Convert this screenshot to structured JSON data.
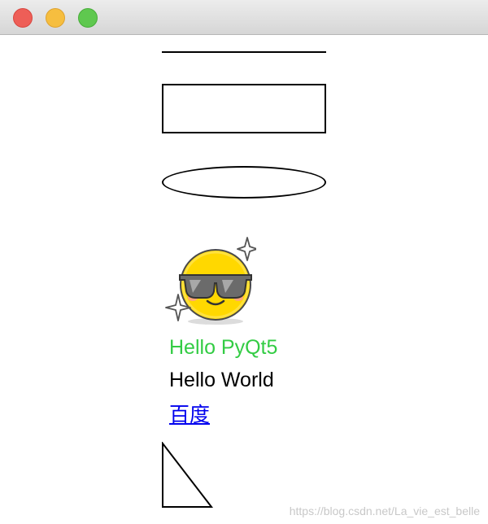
{
  "window": {
    "controls": {
      "close": "close-traffic-light",
      "minimize": "minimize-traffic-light",
      "maximize": "maximize-traffic-light"
    }
  },
  "labels": {
    "greeting": "Hello PyQt5",
    "greeting_color": "#33cc44",
    "hello_world": "Hello World",
    "link_text": "百度",
    "link_color": "#0000ee"
  },
  "image": {
    "icon": "cool-sunglasses-emoji-icon"
  },
  "watermark": "https://blog.csdn.net/La_vie_est_belle"
}
